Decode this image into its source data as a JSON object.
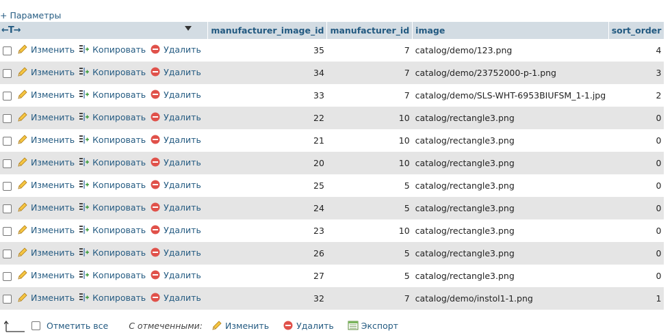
{
  "options_link": "Параметры",
  "header": {
    "columns": [
      "manufacturer_image_id",
      "manufacturer_id",
      "image",
      "sort_order"
    ]
  },
  "row_actions": {
    "edit": "Изменить",
    "copy": "Копировать",
    "delete": "Удалить"
  },
  "rows": [
    {
      "manufacturer_image_id": "35",
      "manufacturer_id": "7",
      "image": "catalog/demo/123.png",
      "sort_order": "4"
    },
    {
      "manufacturer_image_id": "34",
      "manufacturer_id": "7",
      "image": "catalog/demo/23752000-p-1.png",
      "sort_order": "3"
    },
    {
      "manufacturer_image_id": "33",
      "manufacturer_id": "7",
      "image": "catalog/demo/SLS-WHT-6953BIUFSM_1-1.jpg",
      "sort_order": "2"
    },
    {
      "manufacturer_image_id": "22",
      "manufacturer_id": "10",
      "image": "catalog/rectangle3.png",
      "sort_order": "0"
    },
    {
      "manufacturer_image_id": "21",
      "manufacturer_id": "10",
      "image": "catalog/rectangle3.png",
      "sort_order": "0"
    },
    {
      "manufacturer_image_id": "20",
      "manufacturer_id": "10",
      "image": "catalog/rectangle3.png",
      "sort_order": "0"
    },
    {
      "manufacturer_image_id": "25",
      "manufacturer_id": "5",
      "image": "catalog/rectangle3.png",
      "sort_order": "0"
    },
    {
      "manufacturer_image_id": "24",
      "manufacturer_id": "5",
      "image": "catalog/rectangle3.png",
      "sort_order": "0"
    },
    {
      "manufacturer_image_id": "23",
      "manufacturer_id": "10",
      "image": "catalog/rectangle3.png",
      "sort_order": "0"
    },
    {
      "manufacturer_image_id": "26",
      "manufacturer_id": "5",
      "image": "catalog/rectangle3.png",
      "sort_order": "0"
    },
    {
      "manufacturer_image_id": "27",
      "manufacturer_id": "5",
      "image": "catalog/rectangle3.png",
      "sort_order": "0"
    },
    {
      "manufacturer_image_id": "32",
      "manufacturer_id": "7",
      "image": "catalog/demo/instol1-1.png",
      "sort_order": "1"
    }
  ],
  "footer": {
    "check_all": "Отметить все",
    "with_selected": "С отмеченными:",
    "edit": "Изменить",
    "delete": "Удалить",
    "export": "Экспорт"
  },
  "colors": {
    "link": "#235a81",
    "header_bg": "#d3dce3",
    "row_alt_bg": "#e5e5e5",
    "delete_icon": "#e0514a",
    "pencil_icon": "#e6a817"
  }
}
